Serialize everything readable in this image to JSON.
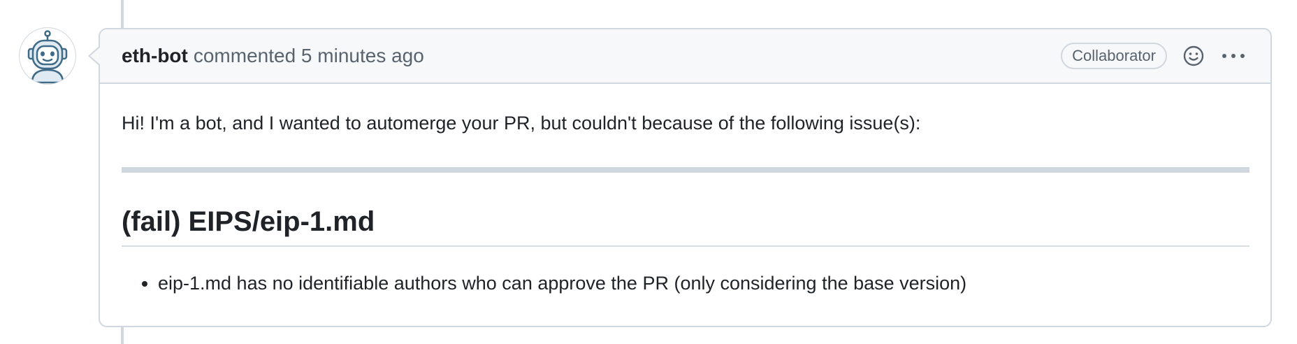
{
  "comment": {
    "author": "eth-bot",
    "action": "commented 5 minutes ago",
    "role_badge": "Collaborator",
    "body": {
      "intro": "Hi! I'm a bot, and I wanted to automerge your PR, but couldn't because of the following issue(s):",
      "heading": "(fail) EIPS/eip-1.md",
      "issues": [
        "eip-1.md has no identifiable authors who can approve the PR (only considering the base version)"
      ]
    }
  },
  "icons": {
    "avatar": "robot-avatar",
    "emoji": "smiley-icon",
    "more": "kebab-horizontal-icon"
  },
  "colors": {
    "border": "#d0d7de",
    "header_bg": "#f6f8fa",
    "text": "#1f2328",
    "muted": "#59636e",
    "avatar_stroke": "#3f6b88",
    "avatar_fill": "#dfeaf2"
  }
}
